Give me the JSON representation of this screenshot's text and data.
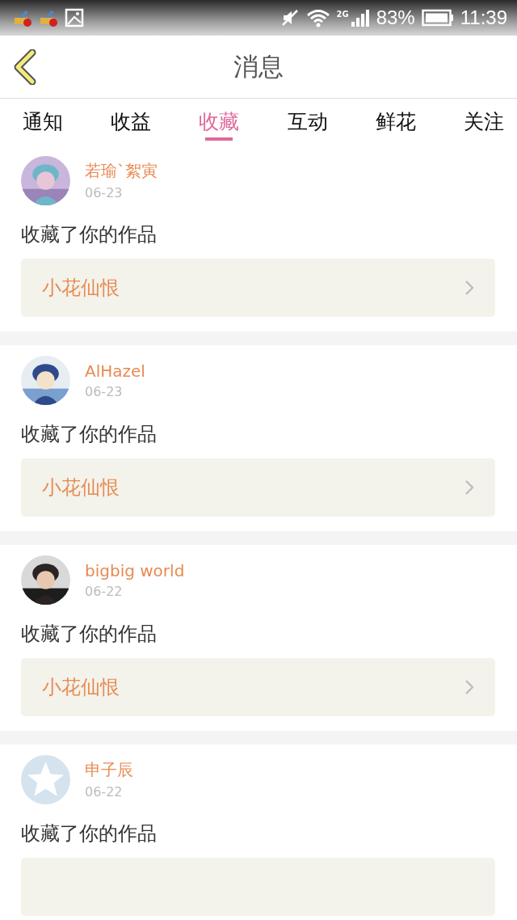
{
  "status_bar": {
    "network": "2G",
    "battery": "83%",
    "time": "11:39"
  },
  "header": {
    "title": "消息"
  },
  "tabs": [
    {
      "label": "通知",
      "selected": false
    },
    {
      "label": "收益",
      "selected": false
    },
    {
      "label": "收藏",
      "selected": true
    },
    {
      "label": "互动",
      "selected": false
    },
    {
      "label": "鲜花",
      "selected": false
    },
    {
      "label": "关注",
      "selected": false
    }
  ],
  "messages": [
    {
      "user": "若瑜`絮寅",
      "date": "06-23",
      "text": "收藏了你的作品",
      "work": "小花仙恨"
    },
    {
      "user": "AlHazel",
      "date": "06-23",
      "text": "收藏了你的作品",
      "work": "小花仙恨"
    },
    {
      "user": "bigbig world",
      "date": "06-22",
      "text": "收藏了你的作品",
      "work": "小花仙恨"
    },
    {
      "user": "申子辰",
      "date": "06-22",
      "avatar": {
        "kind": "default"
      },
      "text": "收藏了你的作品"
    }
  ]
}
